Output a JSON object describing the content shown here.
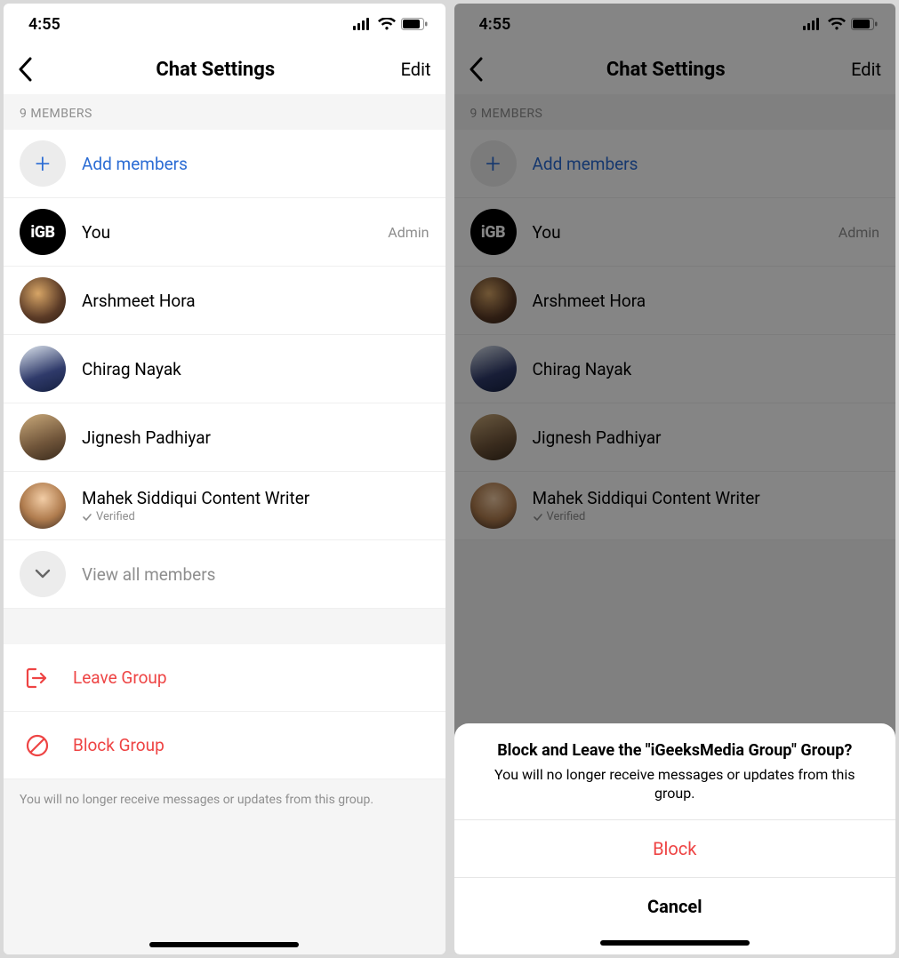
{
  "status": {
    "time": "4:55"
  },
  "nav": {
    "title": "Chat Settings",
    "edit_label": "Edit"
  },
  "members_header": "9 MEMBERS",
  "add_members_label": "Add members",
  "members": [
    {
      "name": "You",
      "badge": "Admin",
      "avatar_text": "iGB"
    },
    {
      "name": "Arshmeet Hora"
    },
    {
      "name": "Chirag Nayak"
    },
    {
      "name": "Jignesh Padhiyar"
    },
    {
      "name": "Mahek Siddiqui Content Writer",
      "verified_label": "Verified"
    }
  ],
  "view_all_label": "View all members",
  "actions": {
    "leave_label": "Leave Group",
    "block_label": "Block Group",
    "footer_note": "You will no longer receive messages or updates from this group."
  },
  "sheet": {
    "title": "Block and Leave the \"iGeeksMedia Group\" Group?",
    "subtitle": "You will no longer receive messages or updates from this group.",
    "block_label": "Block",
    "cancel_label": "Cancel"
  }
}
